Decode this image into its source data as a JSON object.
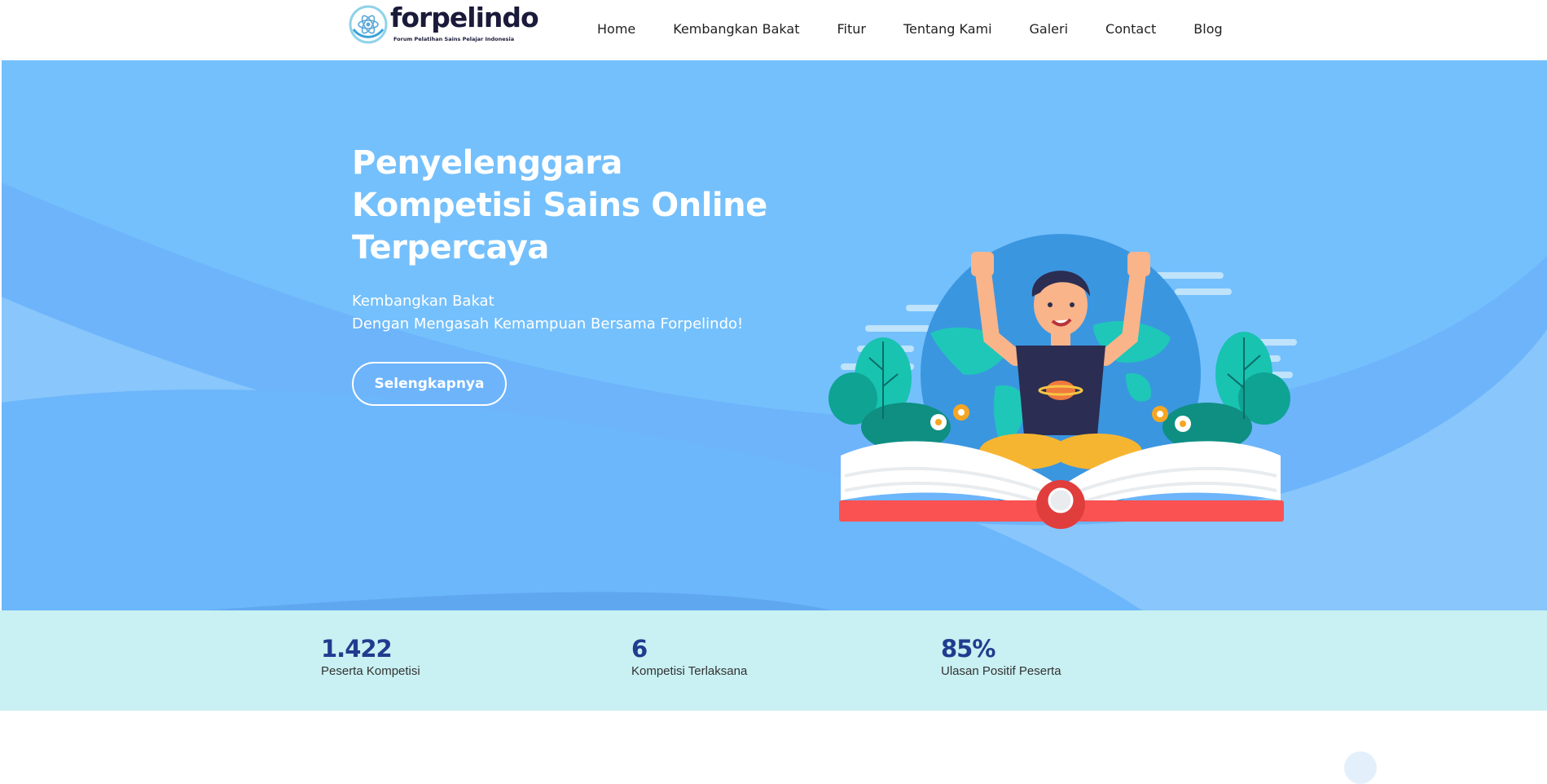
{
  "brand": {
    "name": "forpelindo",
    "tagline": "Forum Pelatihan Sains Pelajar Indonesia"
  },
  "nav": {
    "items": [
      "Home",
      "Kembangkan Bakat",
      "Fitur",
      "Tentang Kami",
      "Galeri",
      "Contact",
      "Blog"
    ]
  },
  "hero": {
    "title": "Penyelenggara Kompetisi Sains Online Terpercaya",
    "subtitle_line1": "Kembangkan Bakat",
    "subtitle_line2": "Dengan Mengasah Kemampuan Bersama Forpelindo!",
    "cta_label": "Selengkapnya"
  },
  "stats": [
    {
      "value": "1.422",
      "label": "Peserta Kompetisi"
    },
    {
      "value": "6",
      "label": "Kompetisi Terlaksana"
    },
    {
      "value": "85%",
      "label": "Ulasan Positif Peserta"
    }
  ],
  "colors": {
    "hero_bg": "#74c0fc",
    "stats_bg": "#c9f0f2",
    "stat_number": "#1f3c8f",
    "book_red": "#fa5252"
  },
  "icons": {
    "logo": "atom-logo-icon",
    "illustration": "student-reading-book-illustration"
  }
}
